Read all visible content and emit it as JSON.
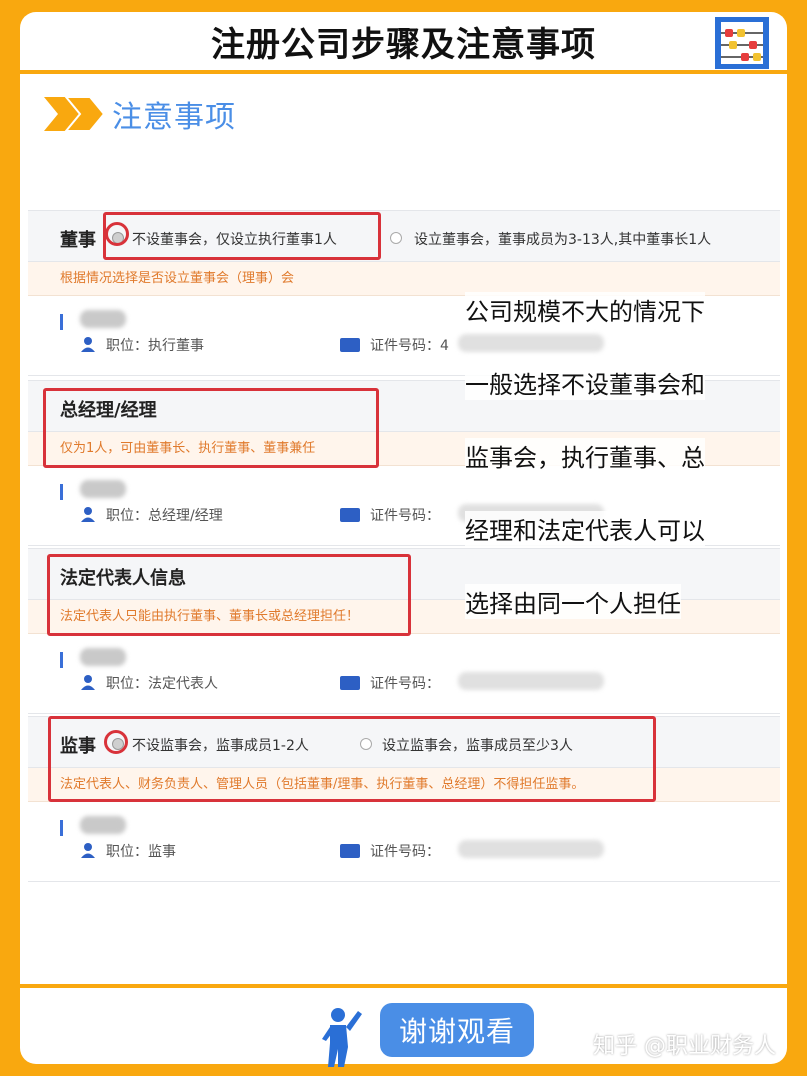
{
  "title": "注册公司步骤及注意事项",
  "section_label": "注意事项",
  "blocks": {
    "directors": {
      "label": "董事",
      "opt1": "不设董事会，仅设立执行董事1人",
      "opt2": "设立董事会，董事成员为3-13人,其中董事长1人",
      "note": "根据情况选择是否设立董事会（理事）会",
      "position": "职位：执行董事",
      "id_label": "证件号码：4"
    },
    "manager": {
      "label": "总经理/经理",
      "note": "仅为1人，可由董事长、执行董事、董事兼任",
      "position": "职位：总经理/经理",
      "id_label": "证件号码："
    },
    "legal_rep": {
      "label": "法定代表人信息",
      "note": "法定代表人只能由执行董事、董事长或总经理担任！",
      "position": "职位：法定代表人",
      "id_label": "证件号码："
    },
    "supervisor": {
      "label": "监事",
      "opt1": "不设监事会，监事成员1-2人",
      "opt2": "设立监事会，监事成员至少3人",
      "note": "法定代表人、财务负责人、管理人员（包括董事/理事、执行董事、总经理）不得担任监事。",
      "position": "职位：监事",
      "id_label": "证件号码："
    }
  },
  "overlay_lines": [
    "公司规模不大的情况下",
    "一般选择不设董事会和",
    "监事会，执行董事、总",
    "经理和法定代表人可以",
    "选择由同一个人担任"
  ],
  "footer": {
    "thanks": "谢谢观看",
    "watermark": "知乎 @职业财务人"
  },
  "colors": {
    "background": "#f9a80f",
    "accent_blue": "#4a8ee6",
    "highlight_red": "#d8323a",
    "warning_orange": "#e07a2c"
  },
  "icons": [
    "abacus-icon",
    "double-arrow-icon",
    "person-icon",
    "id-card-icon",
    "cheering-person-icon"
  ]
}
